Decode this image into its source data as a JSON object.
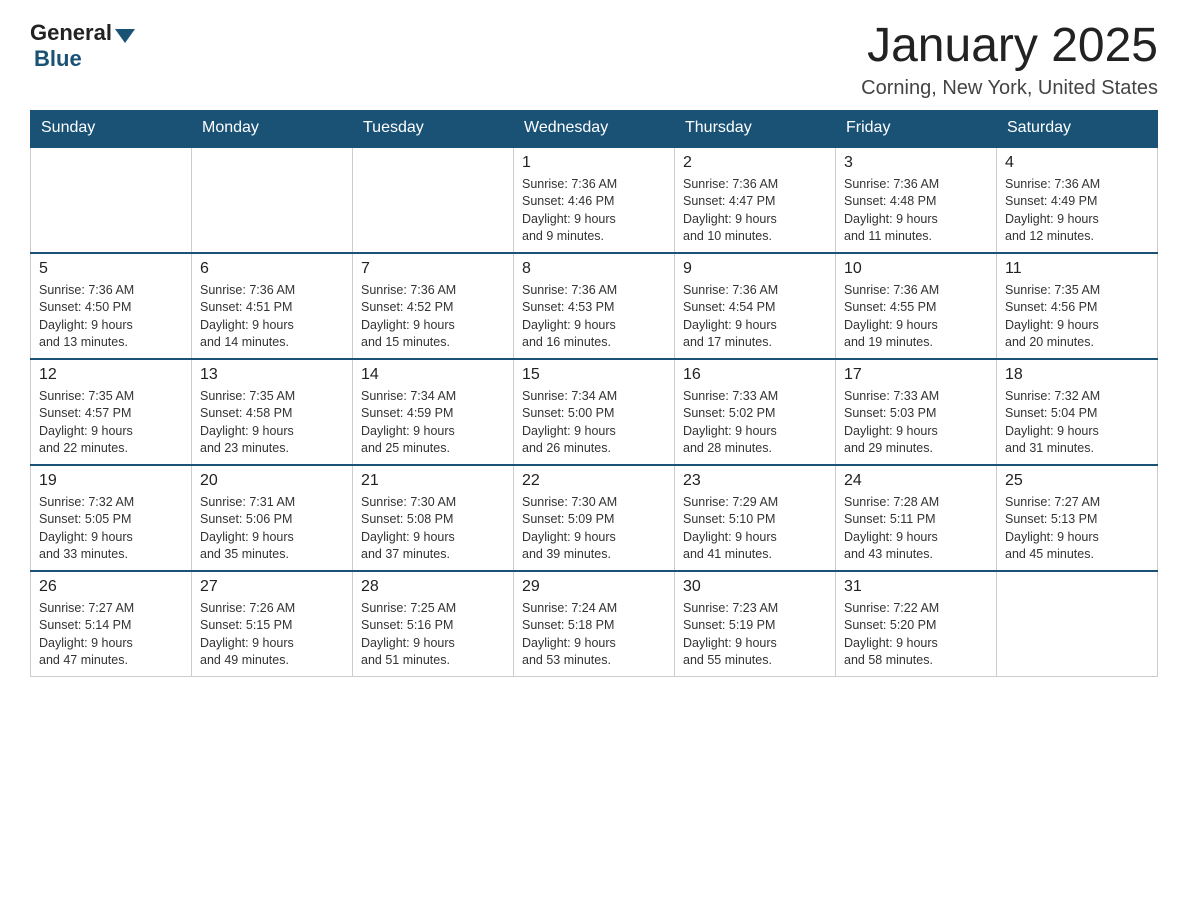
{
  "logo": {
    "general": "General",
    "blue": "Blue"
  },
  "title": "January 2025",
  "subtitle": "Corning, New York, United States",
  "days_of_week": [
    "Sunday",
    "Monday",
    "Tuesday",
    "Wednesday",
    "Thursday",
    "Friday",
    "Saturday"
  ],
  "weeks": [
    [
      {
        "day": "",
        "info": ""
      },
      {
        "day": "",
        "info": ""
      },
      {
        "day": "",
        "info": ""
      },
      {
        "day": "1",
        "info": "Sunrise: 7:36 AM\nSunset: 4:46 PM\nDaylight: 9 hours\nand 9 minutes."
      },
      {
        "day": "2",
        "info": "Sunrise: 7:36 AM\nSunset: 4:47 PM\nDaylight: 9 hours\nand 10 minutes."
      },
      {
        "day": "3",
        "info": "Sunrise: 7:36 AM\nSunset: 4:48 PM\nDaylight: 9 hours\nand 11 minutes."
      },
      {
        "day": "4",
        "info": "Sunrise: 7:36 AM\nSunset: 4:49 PM\nDaylight: 9 hours\nand 12 minutes."
      }
    ],
    [
      {
        "day": "5",
        "info": "Sunrise: 7:36 AM\nSunset: 4:50 PM\nDaylight: 9 hours\nand 13 minutes."
      },
      {
        "day": "6",
        "info": "Sunrise: 7:36 AM\nSunset: 4:51 PM\nDaylight: 9 hours\nand 14 minutes."
      },
      {
        "day": "7",
        "info": "Sunrise: 7:36 AM\nSunset: 4:52 PM\nDaylight: 9 hours\nand 15 minutes."
      },
      {
        "day": "8",
        "info": "Sunrise: 7:36 AM\nSunset: 4:53 PM\nDaylight: 9 hours\nand 16 minutes."
      },
      {
        "day": "9",
        "info": "Sunrise: 7:36 AM\nSunset: 4:54 PM\nDaylight: 9 hours\nand 17 minutes."
      },
      {
        "day": "10",
        "info": "Sunrise: 7:36 AM\nSunset: 4:55 PM\nDaylight: 9 hours\nand 19 minutes."
      },
      {
        "day": "11",
        "info": "Sunrise: 7:35 AM\nSunset: 4:56 PM\nDaylight: 9 hours\nand 20 minutes."
      }
    ],
    [
      {
        "day": "12",
        "info": "Sunrise: 7:35 AM\nSunset: 4:57 PM\nDaylight: 9 hours\nand 22 minutes."
      },
      {
        "day": "13",
        "info": "Sunrise: 7:35 AM\nSunset: 4:58 PM\nDaylight: 9 hours\nand 23 minutes."
      },
      {
        "day": "14",
        "info": "Sunrise: 7:34 AM\nSunset: 4:59 PM\nDaylight: 9 hours\nand 25 minutes."
      },
      {
        "day": "15",
        "info": "Sunrise: 7:34 AM\nSunset: 5:00 PM\nDaylight: 9 hours\nand 26 minutes."
      },
      {
        "day": "16",
        "info": "Sunrise: 7:33 AM\nSunset: 5:02 PM\nDaylight: 9 hours\nand 28 minutes."
      },
      {
        "day": "17",
        "info": "Sunrise: 7:33 AM\nSunset: 5:03 PM\nDaylight: 9 hours\nand 29 minutes."
      },
      {
        "day": "18",
        "info": "Sunrise: 7:32 AM\nSunset: 5:04 PM\nDaylight: 9 hours\nand 31 minutes."
      }
    ],
    [
      {
        "day": "19",
        "info": "Sunrise: 7:32 AM\nSunset: 5:05 PM\nDaylight: 9 hours\nand 33 minutes."
      },
      {
        "day": "20",
        "info": "Sunrise: 7:31 AM\nSunset: 5:06 PM\nDaylight: 9 hours\nand 35 minutes."
      },
      {
        "day": "21",
        "info": "Sunrise: 7:30 AM\nSunset: 5:08 PM\nDaylight: 9 hours\nand 37 minutes."
      },
      {
        "day": "22",
        "info": "Sunrise: 7:30 AM\nSunset: 5:09 PM\nDaylight: 9 hours\nand 39 minutes."
      },
      {
        "day": "23",
        "info": "Sunrise: 7:29 AM\nSunset: 5:10 PM\nDaylight: 9 hours\nand 41 minutes."
      },
      {
        "day": "24",
        "info": "Sunrise: 7:28 AM\nSunset: 5:11 PM\nDaylight: 9 hours\nand 43 minutes."
      },
      {
        "day": "25",
        "info": "Sunrise: 7:27 AM\nSunset: 5:13 PM\nDaylight: 9 hours\nand 45 minutes."
      }
    ],
    [
      {
        "day": "26",
        "info": "Sunrise: 7:27 AM\nSunset: 5:14 PM\nDaylight: 9 hours\nand 47 minutes."
      },
      {
        "day": "27",
        "info": "Sunrise: 7:26 AM\nSunset: 5:15 PM\nDaylight: 9 hours\nand 49 minutes."
      },
      {
        "day": "28",
        "info": "Sunrise: 7:25 AM\nSunset: 5:16 PM\nDaylight: 9 hours\nand 51 minutes."
      },
      {
        "day": "29",
        "info": "Sunrise: 7:24 AM\nSunset: 5:18 PM\nDaylight: 9 hours\nand 53 minutes."
      },
      {
        "day": "30",
        "info": "Sunrise: 7:23 AM\nSunset: 5:19 PM\nDaylight: 9 hours\nand 55 minutes."
      },
      {
        "day": "31",
        "info": "Sunrise: 7:22 AM\nSunset: 5:20 PM\nDaylight: 9 hours\nand 58 minutes."
      },
      {
        "day": "",
        "info": ""
      }
    ]
  ]
}
